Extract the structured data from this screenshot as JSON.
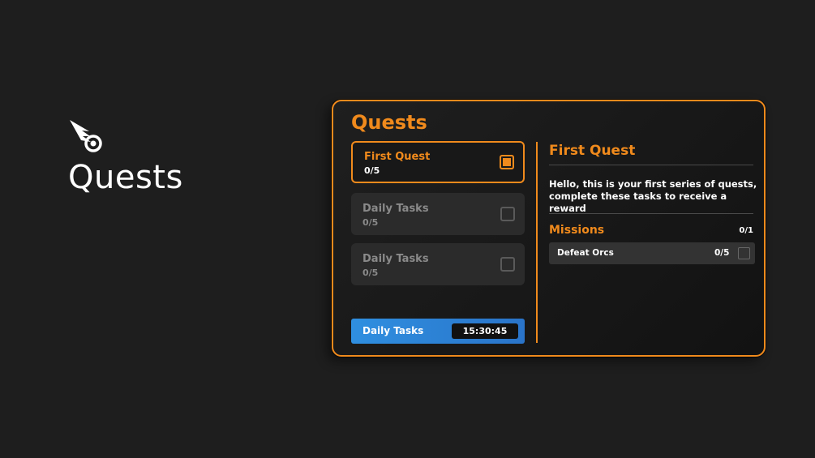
{
  "brand": {
    "title": "Quests",
    "icon": "comet-icon"
  },
  "panel": {
    "title": "Quests",
    "quests": [
      {
        "name": "First Quest",
        "progress": "0/5",
        "active": true
      },
      {
        "name": "Daily Tasks",
        "progress": "0/5",
        "active": false
      },
      {
        "name": "Daily Tasks",
        "progress": "0/5",
        "active": false
      }
    ],
    "daily": {
      "label": "Daily Tasks",
      "timer": "15:30:45"
    }
  },
  "detail": {
    "title": "First Quest",
    "description": "Hello, this is your first series of quests, complete these tasks to receive a reward",
    "missions_label": "Missions",
    "missions_count": "0/1",
    "missions": [
      {
        "name": "Defeat Orcs",
        "progress": "0/5"
      }
    ]
  },
  "colors": {
    "accent": "#f08a1c",
    "background": "#1e1e1e",
    "card": "#2b2b2b",
    "daily_bar": "#2f8fe0"
  }
}
